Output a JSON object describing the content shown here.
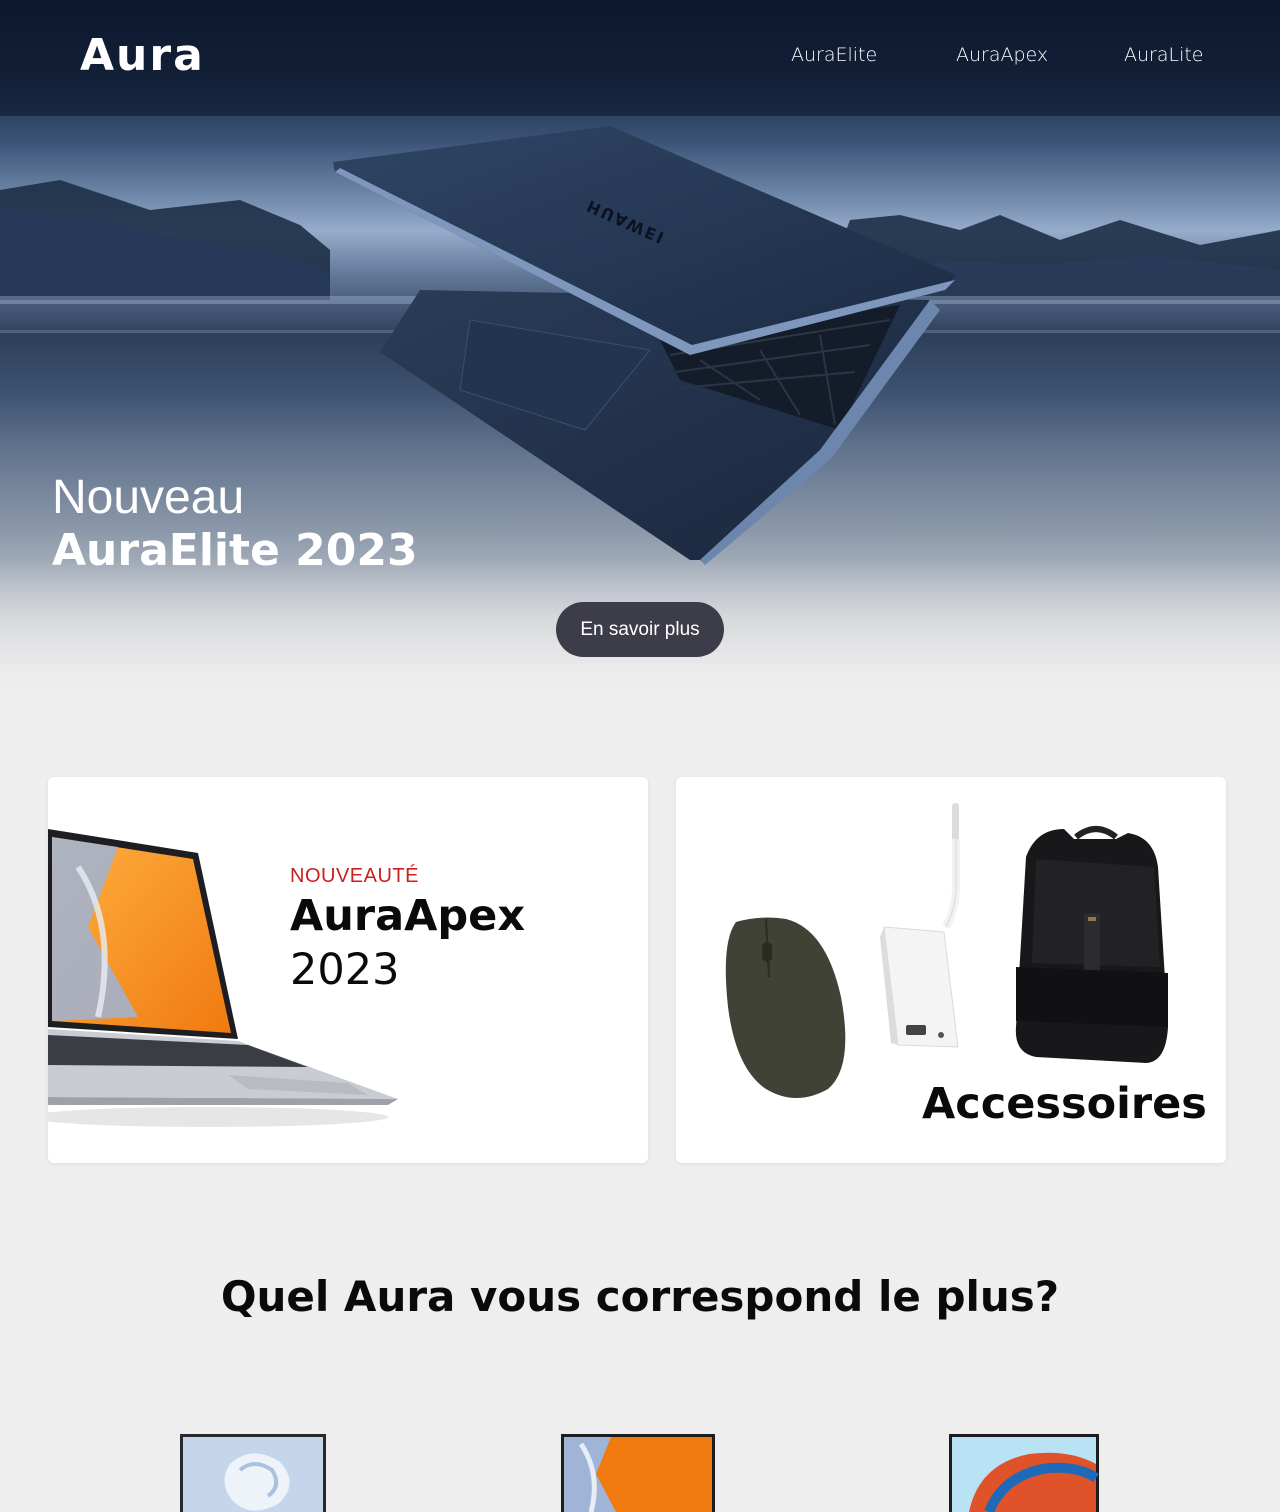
{
  "header": {
    "logo": "Aura",
    "nav": [
      "AuraElite",
      "AuraApex",
      "AuraLite"
    ]
  },
  "hero": {
    "line1": "Nouveau",
    "line2": "AuraElite 2023",
    "cta_label": "En savoir plus",
    "laptop_brand": "HUAWEI"
  },
  "cards": {
    "apex": {
      "kicker": "NOUVEAUTÉ",
      "title": "AuraApex",
      "year": "2023"
    },
    "accessories": {
      "title": "Accessoires"
    }
  },
  "section": {
    "title": "Quel Aura vous correspond le plus?"
  },
  "colors": {
    "accent_red": "#cc1f1f",
    "page_bg": "#eeeeee",
    "button_bg": "#3c3d48",
    "nav_bg": "#0f1c33"
  }
}
